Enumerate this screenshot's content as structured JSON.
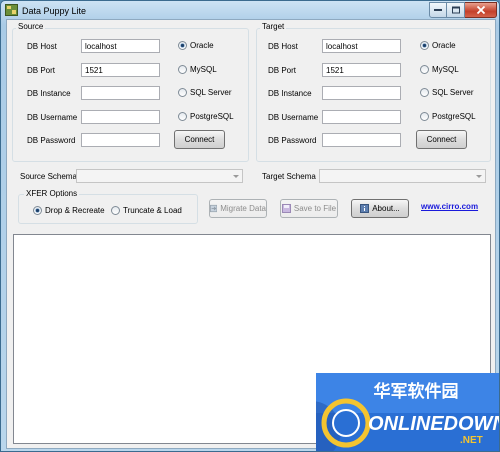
{
  "window": {
    "title": "Data Puppy Lite"
  },
  "source": {
    "group_title": "Source",
    "fields": [
      {
        "label": "DB Host",
        "value": "localhost"
      },
      {
        "label": "DB Port",
        "value": "1521"
      },
      {
        "label": "DB Instance",
        "value": ""
      },
      {
        "label": "DB Username",
        "value": ""
      },
      {
        "label": "DB Password",
        "value": ""
      }
    ],
    "db_types": [
      "Oracle",
      "MySQL",
      "SQL Server",
      "PostgreSQL"
    ],
    "selected_db": "Oracle",
    "connect_label": "Connect",
    "schema_label": "Source Schema"
  },
  "target": {
    "group_title": "Target",
    "fields": [
      {
        "label": "DB Host",
        "value": "localhost"
      },
      {
        "label": "DB Port",
        "value": "1521"
      },
      {
        "label": "DB Instance",
        "value": ""
      },
      {
        "label": "DB Username",
        "value": ""
      },
      {
        "label": "DB Password",
        "value": ""
      }
    ],
    "db_types": [
      "Oracle",
      "MySQL",
      "SQL Server",
      "PostgreSQL"
    ],
    "selected_db": "Oracle",
    "connect_label": "Connect",
    "schema_label": "Target Schema"
  },
  "xfer": {
    "group_title": "XFER Options",
    "options": [
      "Drop & Recreate",
      "Truncate & Load"
    ],
    "selected": "Drop & Recreate"
  },
  "actions": {
    "migrate_label": "Migrate Data",
    "save_label": "Save to File",
    "about_label": "About..."
  },
  "link_text": "www.cirro.com",
  "watermark": {
    "cn": "华军软件园",
    "en": "ONLINEDOWN",
    "tld": ".NET"
  }
}
